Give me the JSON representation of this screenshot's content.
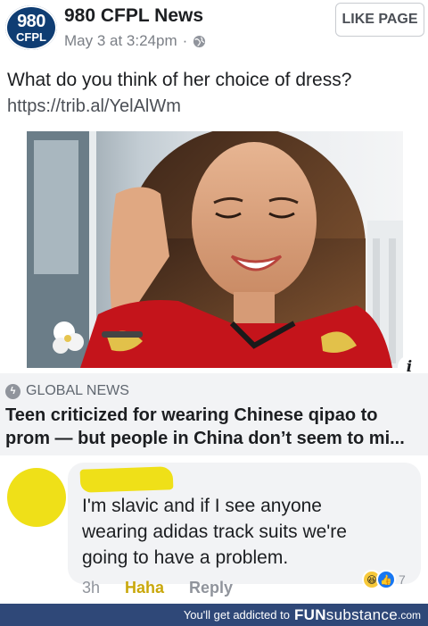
{
  "header": {
    "logo_line1": "980",
    "logo_line2": "CFPL",
    "page_name": "980 CFPL News",
    "timestamp": "May 3 at 3:24pm",
    "separator": "·",
    "like_button": "LIKE PAGE"
  },
  "post": {
    "text": "What do you think of her choice of dress?",
    "link": "https://trib.al/YelAlWm"
  },
  "link_preview": {
    "source": "GLOBAL NEWS",
    "title": "Teen criticized for wearing Chinese qipao to prom — but people in China don’t seem to mi..."
  },
  "comment": {
    "lines": [
      "I'm slavic and if I see anyone",
      "wearing adidas track suits we're",
      "going to have a problem."
    ],
    "time": "3h",
    "haha_label": "Haha",
    "reply_label": "Reply",
    "reaction_count": "7"
  },
  "footer": {
    "lead": "You'll get addicted to",
    "brand_main": "FUN",
    "brand_sub": "substance",
    "domain": ".com"
  },
  "colors": {
    "logo_bg": "#0f3d73",
    "redaction": "#efe018",
    "haha": "#c9a80c",
    "footer_bg": "#2f4878"
  }
}
